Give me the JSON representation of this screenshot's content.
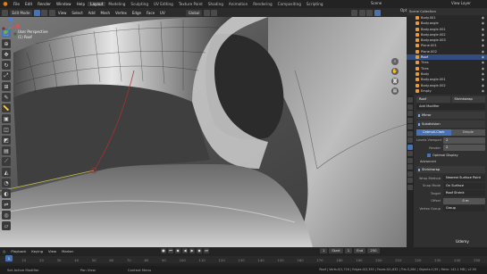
{
  "topbar": {
    "menus": [
      "File",
      "Edit",
      "Render",
      "Window",
      "Help"
    ],
    "workspaces": [
      "Layout",
      "Modeling",
      "Sculpting",
      "UV Editing",
      "Texture Paint",
      "Shading",
      "Animation",
      "Rendering",
      "Compositing",
      "Scripting"
    ],
    "active_workspace": "Layout",
    "scene": "Scene",
    "view_layer": "View Layer"
  },
  "viewport_header": {
    "mode": "Edit Mode",
    "menus": [
      "View",
      "Select",
      "Add",
      "Mesh",
      "Vertex",
      "Edge",
      "Face",
      "UV"
    ],
    "orientation": "Global",
    "options": "Options"
  },
  "viewport": {
    "view_name": "User Perspective",
    "object_name": "(1) Roof"
  },
  "toolbar": {
    "tools": [
      "select-icon",
      "cursor-icon",
      "move-icon",
      "rotate-icon",
      "scale-icon",
      "transform-icon",
      "annotate-icon",
      "measure-icon",
      "extrude-icon",
      "inset-icon",
      "bevel-icon",
      "loopcut-icon",
      "knife-icon",
      "polybuild-icon",
      "spin-icon",
      "smooth-icon",
      "edge-slide-icon",
      "shrink-icon",
      "shear-icon",
      "rip-icon"
    ]
  },
  "outliner": {
    "title": "Scene Collection",
    "rows": [
      {
        "label": "Body.001",
        "selected": false
      },
      {
        "label": "Body.angle",
        "selected": false
      },
      {
        "label": "Body.angle.001",
        "selected": false
      },
      {
        "label": "Body.angle.002",
        "selected": false
      },
      {
        "label": "Body.angle.003",
        "selected": false
      },
      {
        "label": "Plane.001",
        "selected": false
      },
      {
        "label": "Plane.002",
        "selected": false
      },
      {
        "label": "Roof",
        "selected": true
      },
      {
        "label": "Tires",
        "selected": false
      },
      {
        "label": "Tires",
        "selected": false
      },
      {
        "label": "Body",
        "selected": false
      },
      {
        "label": "Body.angle.001",
        "selected": false
      },
      {
        "label": "Body.angle.002",
        "selected": false
      },
      {
        "label": "Empty",
        "selected": false
      }
    ]
  },
  "properties": {
    "object_name": "Roof",
    "modifier_name": "Shrinkwrap",
    "add_modifier": "Add Modifier",
    "modifiers": [
      "Mirror",
      "Subdivision"
    ],
    "subdiv_tabs": [
      "Catmull-Clark",
      "Simple"
    ],
    "levels_viewport_label": "Levels Viewport",
    "levels_viewport": "2",
    "render_label": "Render",
    "render": "2",
    "optimal_display": "Optimal Display",
    "advanced": "Advanced",
    "shrinkwrap": "Shrinkwrap",
    "wrap_method_label": "Wrap Method",
    "wrap_method": "Nearest Surface Point",
    "snap_mode_label": "Snap Mode",
    "snap_mode": "On Surface",
    "target_label": "Target",
    "target": "Roof Shrink",
    "offset_label": "Offset",
    "offset": "0 m",
    "vertex_group_label": "Vertex Group",
    "vertex_group": "Group"
  },
  "timeline": {
    "menus": [
      "Playback",
      "Keying",
      "View",
      "Marker"
    ],
    "current_frame": "1",
    "start_label": "Start",
    "start": "1",
    "end_label": "End",
    "end": "250",
    "ticks": [
      "0",
      "10",
      "20",
      "30",
      "40",
      "50",
      "60",
      "70",
      "80",
      "90",
      "100",
      "110",
      "120",
      "130",
      "140",
      "150",
      "160",
      "170",
      "180",
      "190",
      "200",
      "210",
      "220",
      "230",
      "240",
      "250"
    ]
  },
  "statusbar": {
    "items": [
      "Set Active Modifier",
      "Pan View",
      "Context Menu"
    ],
    "stats": "Roof | Verts:0/1,716 | Edges:0/3,350 | Faces:0/1,632 | Tris:3,264 | Objects:1/35 | Mem: 142.1 MB | v2.90"
  },
  "watermark": "Udemy",
  "colors": {
    "accent": "#4772b3",
    "outliner_selected": "#334d80",
    "blender_orange": "#e87d0d"
  }
}
